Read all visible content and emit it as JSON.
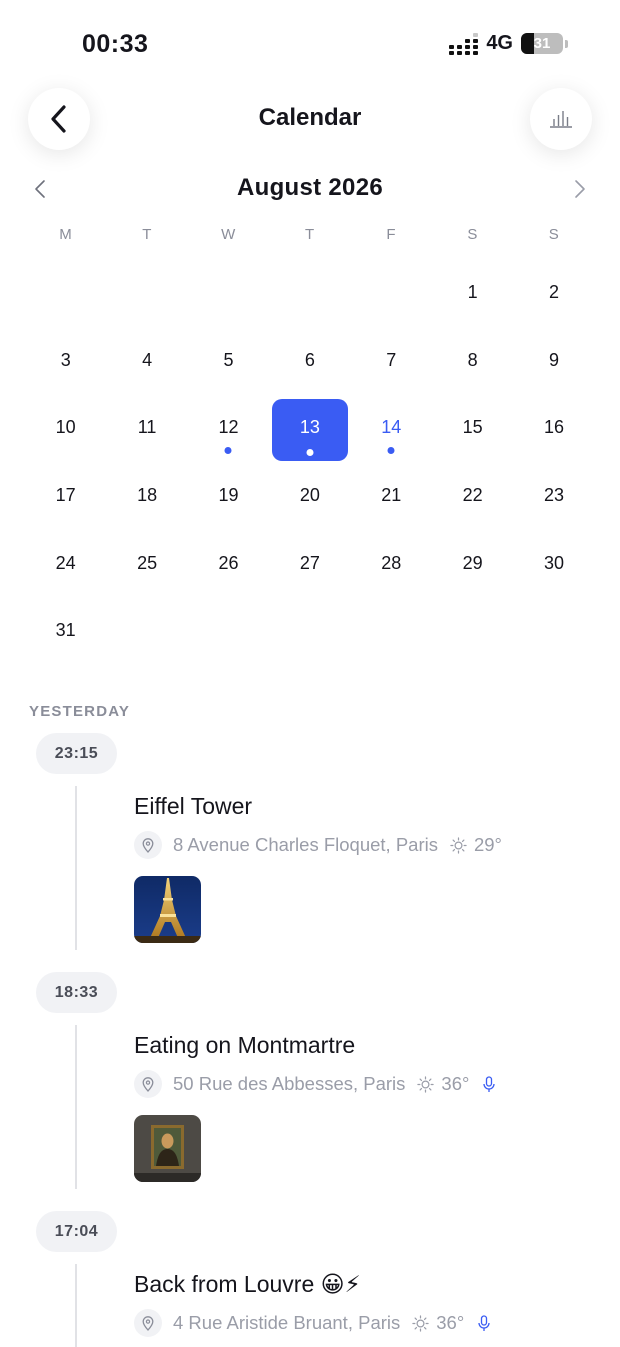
{
  "status_bar": {
    "time": "00:33",
    "network": "4G",
    "battery": "31",
    "battery_level": 0.31
  },
  "header": {
    "title": "Calendar",
    "back_icon": "chevron-left-icon",
    "stats_icon": "bar-chart-icon"
  },
  "calendar": {
    "month_title": "August 2026",
    "weekdays": [
      "M",
      "T",
      "W",
      "T",
      "F",
      "S",
      "S"
    ],
    "weeks": [
      [
        "",
        "",
        "",
        "",
        "",
        "1",
        "2"
      ],
      [
        "3",
        "4",
        "5",
        "6",
        "7",
        "8",
        "9"
      ],
      [
        "10",
        "11",
        "12",
        "13",
        "14",
        "15",
        "16"
      ],
      [
        "17",
        "18",
        "19",
        "20",
        "21",
        "22",
        "23"
      ],
      [
        "24",
        "25",
        "26",
        "27",
        "28",
        "29",
        "30"
      ],
      [
        "31",
        "",
        "",
        "",
        "",
        "",
        ""
      ]
    ],
    "selected_day": "13",
    "accent_day": "14",
    "days_with_entries": [
      "12",
      "13",
      "14"
    ],
    "accent_color": "#3a5cf3"
  },
  "timeline": {
    "section_label": "YESTERDAY",
    "entries": [
      {
        "time": "23:15",
        "title": "Eiffel Tower",
        "location": "8 Avenue Charles Floquet, Paris",
        "weather": "29°",
        "has_audio": false,
        "thumbnail": "eiffel-tower-photo"
      },
      {
        "time": "18:33",
        "title": "Eating on Montmartre",
        "location": "50 Rue des Abbesses, Paris",
        "weather": "36°",
        "has_audio": true,
        "thumbnail": "mona-lisa-photo"
      },
      {
        "time": "17:04",
        "title": "Back from Louvre 😀⚡",
        "location": "4 Rue Aristide Bruant, Paris",
        "weather": "36°",
        "has_audio": true,
        "thumbnail": ""
      }
    ]
  }
}
